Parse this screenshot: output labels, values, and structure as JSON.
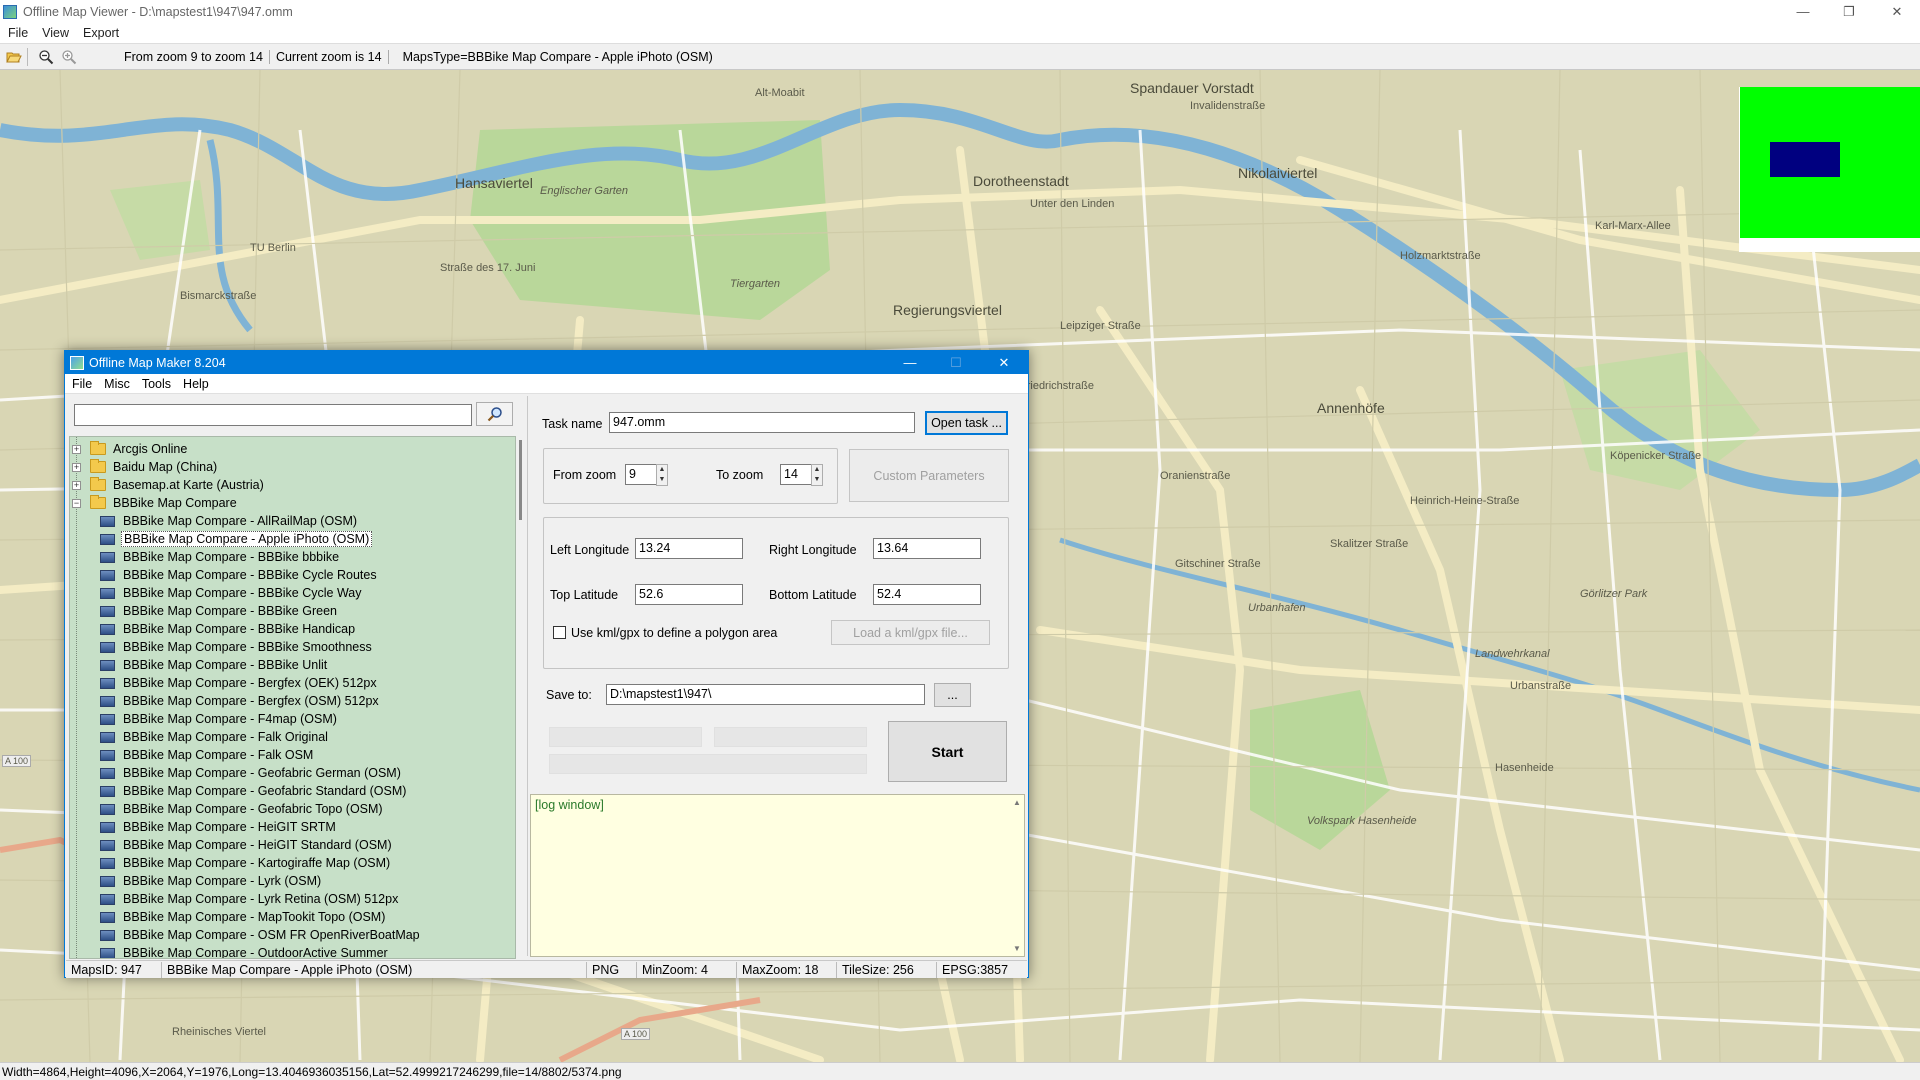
{
  "window": {
    "title": "Offline Map Viewer - D:\\mapstest1\\947\\947.omm",
    "minimize_glyph": "—",
    "maximize_glyph": "❐",
    "close_glyph": "✕"
  },
  "menu": [
    "File",
    "View",
    "Export"
  ],
  "toolbar": {
    "zoom_range": "From zoom 9 to zoom 14",
    "current_zoom": "Current zoom is 14",
    "maps_type": "MapsType=BBBike Map Compare - Apple iPhoto (OSM)"
  },
  "map": {
    "labels": [
      "Spandauer Vorstadt",
      "Nikolaiviertel",
      "Dorotheenstadt",
      "Hansaviertel",
      "Englischer Garten",
      "Tiergarten",
      "Regierungsviertel",
      "Annenhöfe",
      "Urbanhafen",
      "Landwehrkanal",
      "Görlitzer Park",
      "Volkspark Hasenheide",
      "Rheinisches Viertel",
      "Straße des 17. Juni",
      "Unter den Linden",
      "Karl-Marx-Allee",
      "Bismarckstraße",
      "TU Berlin",
      "Leipziger Straße",
      "Urbanstraße",
      "Hasenheide",
      "Gitschiner Straße",
      "Oranienstraße",
      "Skalitzer Straße",
      "Köpenicker Straße",
      "Alt-Moabit",
      "Invalidenstraße",
      "Heinrich-Heine-Straße",
      "Holzmarktstraße",
      "Friedrichstraße",
      "A 100"
    ]
  },
  "statusbar": {
    "text": "Width=4864,Height=4096,X=2064,Y=1976,Long=13.4046936035156,Lat=52.4999217246299,file=14/8802/5374.png"
  },
  "dialog": {
    "title": "Offline Map Maker 8.204",
    "menu": [
      "File",
      "Misc",
      "Tools",
      "Help"
    ],
    "search": {
      "value": ""
    },
    "tree": {
      "folders": [
        {
          "label": "Arcgis Online",
          "expander": "+"
        },
        {
          "label": "Baidu Map (China)",
          "expander": "+"
        },
        {
          "label": "Basemap.at Karte (Austria)",
          "expander": "+"
        },
        {
          "label": "BBBike Map Compare",
          "expander": "−"
        }
      ],
      "items": [
        "BBBike Map Compare - AllRailMap (OSM)",
        "BBBike Map Compare - Apple iPhoto (OSM)",
        "BBBike Map Compare - BBBike bbbike",
        "BBBike Map Compare - BBBike Cycle Routes",
        "BBBike Map Compare - BBBike Cycle Way",
        "BBBike Map Compare - BBBike Green",
        "BBBike Map Compare - BBBike Handicap",
        "BBBike Map Compare - BBBike Smoothness",
        "BBBike Map Compare - BBBike Unlit",
        "BBBike Map Compare - Bergfex (OEK) 512px",
        "BBBike Map Compare - Bergfex (OSM) 512px",
        "BBBike Map Compare - F4map (OSM)",
        "BBBike Map Compare - Falk Original",
        "BBBike Map Compare - Falk OSM",
        "BBBike Map Compare - Geofabric German (OSM)",
        "BBBike Map Compare - Geofabric Standard (OSM)",
        "BBBike Map Compare - Geofabric Topo (OSM)",
        "BBBike Map Compare - HeiGIT SRTM",
        "BBBike Map Compare - HeiGIT Standard (OSM)",
        "BBBike Map Compare - Kartogiraffe Map (OSM)",
        "BBBike Map Compare - Lyrk (OSM)",
        "BBBike Map Compare - Lyrk Retina (OSM) 512px",
        "BBBike Map Compare - MapTookit Topo (OSM)",
        "BBBike Map Compare - OSM FR OpenRiverBoatMap",
        "BBBike Map Compare - OutdoorActive Summer"
      ],
      "selected_index": 1
    },
    "task_name_label": "Task name",
    "task_name": "947.omm",
    "open_task": "Open task ...",
    "from_zoom_label": "From zoom",
    "from_zoom": "9",
    "to_zoom_label": "To zoom",
    "to_zoom": "14",
    "custom_params": "Custom Parameters",
    "left_lon_label": "Left Longitude",
    "left_lon": "13.24",
    "right_lon_label": "Right Longitude",
    "right_lon": "13.64",
    "top_lat_label": "Top Latitude",
    "top_lat": "52.6",
    "bottom_lat_label": "Bottom Latitude",
    "bottom_lat": "52.4",
    "kml_check_label": "Use kml/gpx to define a polygon area",
    "load_kml": "Load a kml/gpx file...",
    "save_to_label": "Save to:",
    "save_to": "D:\\mapstest1\\947\\",
    "browse": "...",
    "start": "Start",
    "log": "[log window]",
    "status": {
      "maps_id": "MapsID: 947",
      "map_name": "BBBike Map Compare - Apple iPhoto (OSM)",
      "format": "PNG",
      "min_zoom": "MinZoom: 4",
      "max_zoom": "MaxZoom: 18",
      "tile_size": "TileSize: 256",
      "epsg": "EPSG:3857"
    }
  }
}
